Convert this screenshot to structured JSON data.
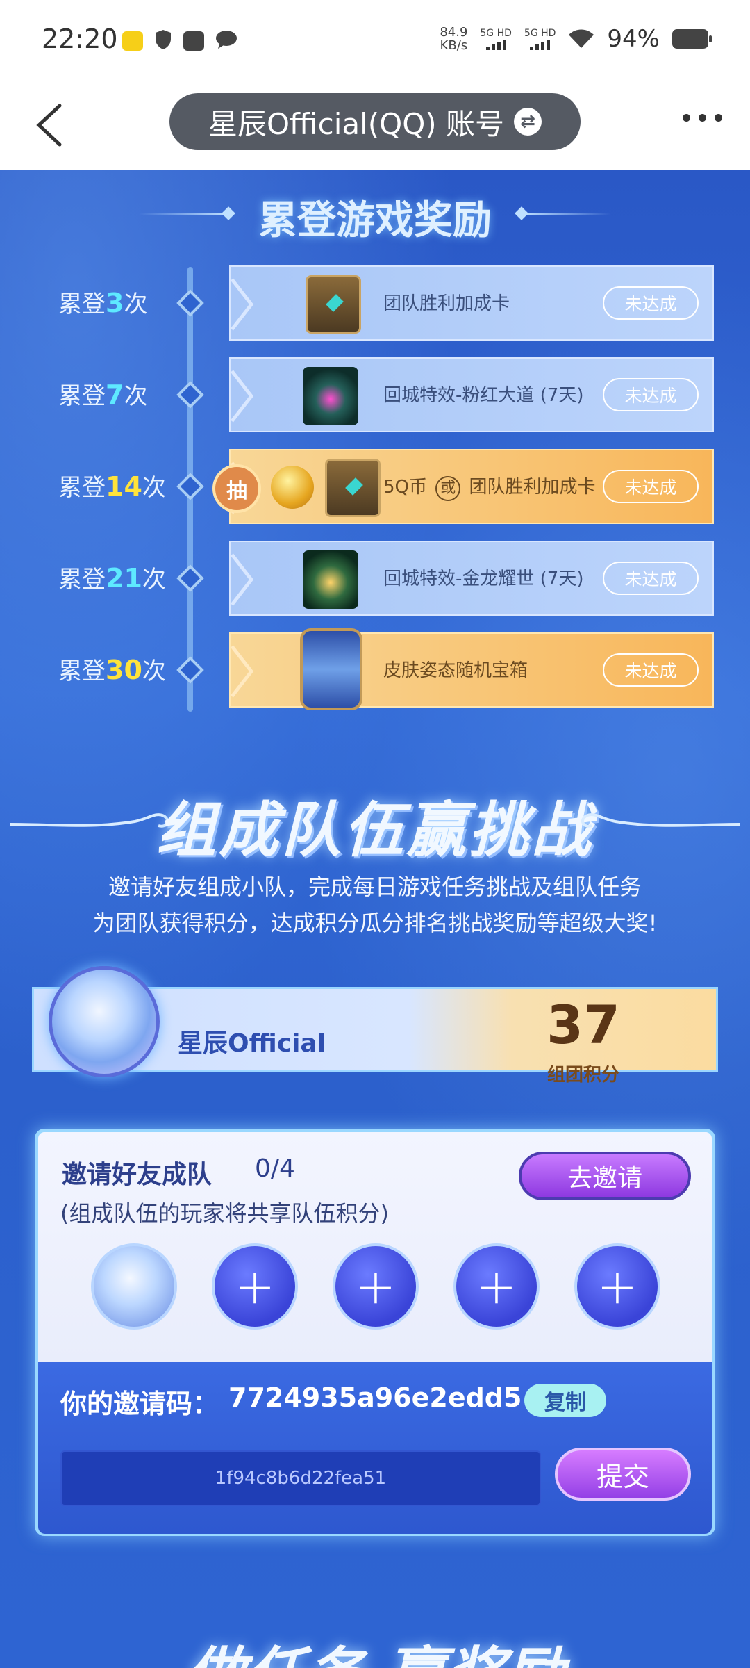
{
  "status_bar": {
    "time": "22:20",
    "net_speed_value": "84.9",
    "net_speed_unit": "KB/s",
    "sim1": "5G HD",
    "sim2": "5G HD",
    "battery": "94%"
  },
  "header": {
    "account_label": "星辰Official(QQ)  账号"
  },
  "login_rewards": {
    "title": "累登游戏奖励",
    "rows": [
      {
        "prefix": "累登",
        "num": "3",
        "suffix": "次",
        "reward": "团队胜利加成卡",
        "status": "未达成"
      },
      {
        "prefix": "累登",
        "num": "7",
        "suffix": "次",
        "reward": "回城特效-粉红大道 (7天)",
        "status": "未达成"
      },
      {
        "prefix": "累登",
        "num": "14",
        "suffix": "次",
        "reward_a": "5Q币",
        "or": "或",
        "reward_b": "团队胜利加成卡",
        "badge": "抽",
        "status": "未达成"
      },
      {
        "prefix": "累登",
        "num": "21",
        "suffix": "次",
        "reward": "回城特效-金龙耀世 (7天)",
        "status": "未达成"
      },
      {
        "prefix": "累登",
        "num": "30",
        "suffix": "次",
        "reward": "皮肤姿态随机宝箱",
        "status": "未达成"
      }
    ]
  },
  "team_challenge": {
    "title": "组成队伍赢挑战",
    "desc_line1": "邀请好友组成小队，完成每日游戏任务挑战及组队任务",
    "desc_line2": "为团队获得积分，达成积分瓜分排名挑战奖励等超级大奖!",
    "team_name": "星辰Official",
    "score": "37",
    "score_label": "组团积分"
  },
  "invite": {
    "title": "邀请好友成队",
    "count": "0/4",
    "subtitle": "(组成队伍的玩家将共享队伍积分)",
    "invite_button": "去邀请",
    "slot_plus": "+",
    "code_label": "你的邀请码：",
    "code_value": "7724935a96e2edd5",
    "copy_button": "复制",
    "input_value": "1f94c8b6d22fea51",
    "submit_button": "提交"
  },
  "next_section": {
    "title": "做任务 赢奖励"
  },
  "colors": {
    "bg_blue": "#2f62cf",
    "gold_card": "#f8b65a",
    "blue_card": "#a9c7f7",
    "highlight_cyan": "#5ee9ff",
    "highlight_yellow": "#ffe33b",
    "purple_button": "#9440e6"
  }
}
